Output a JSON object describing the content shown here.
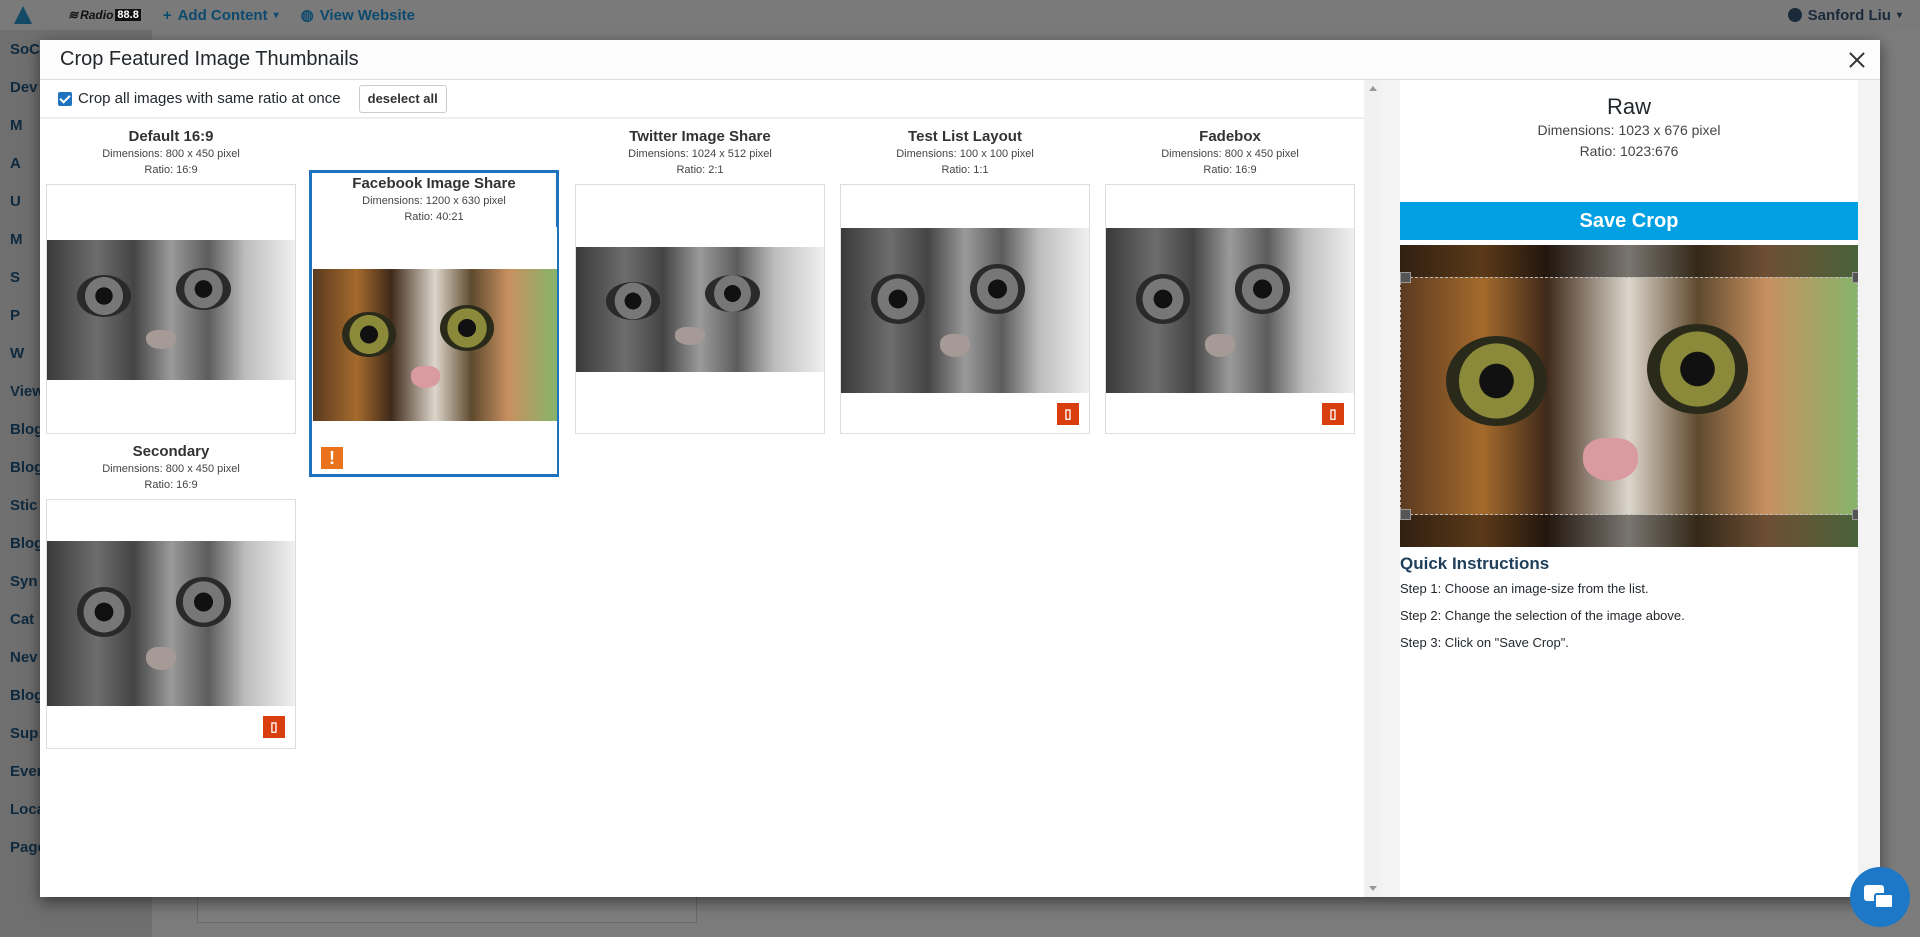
{
  "admin_bar": {
    "radio_logo_text": "Radio",
    "radio_logo_box": "88.8",
    "add_content": "Add Content",
    "view_website": "View Website",
    "user_name": "Sanford Liu"
  },
  "sidebar": {
    "items": [
      "SoCa",
      "Dev",
      "M",
      "A",
      "U",
      "M",
      "S",
      "P",
      "W",
      "View",
      "Blog",
      "Blog",
      "Stic",
      "Blog",
      "Syn",
      "Cat",
      "Nev",
      "Blog",
      "Sup",
      "Ever",
      "Loca",
      "Pages"
    ]
  },
  "modal": {
    "title": "Crop Featured Image Thumbnails",
    "crop_all_label": "Crop all images with same ratio at once",
    "deselect_all_label": "deselect all",
    "thumbnails": [
      {
        "title": "Default 16:9",
        "dimensions": "Dimensions: 800 x 450 pixel",
        "ratio": "Ratio: 16:9"
      },
      {
        "title": "Facebook Image Share",
        "dimensions": "Dimensions: 1200 x 630 pixel",
        "ratio": "Ratio: 40:21",
        "warning": "!"
      },
      {
        "title": "Twitter Image Share",
        "dimensions": "Dimensions: 1024 x 512 pixel",
        "ratio": "Ratio: 2:1"
      },
      {
        "title": "Test List Layout",
        "dimensions": "Dimensions: 100 x 100 pixel",
        "ratio": "Ratio: 1:1",
        "warning": "▯"
      },
      {
        "title": "Fadebox",
        "dimensions": "Dimensions: 800 x 450 pixel",
        "ratio": "Ratio: 16:9",
        "warning": "▯"
      },
      {
        "title": "Secondary",
        "dimensions": "Dimensions: 800 x 450 pixel",
        "ratio": "Ratio: 16:9",
        "warning": "▯"
      }
    ],
    "right": {
      "title": "Raw",
      "dimensions": "Dimensions: 1023 x 676 pixel",
      "ratio": "Ratio: 1023:676",
      "save_label": "Save Crop",
      "qi_title": "Quick Instructions",
      "steps": [
        "Step 1: Choose an image-size from the list.",
        "Step 2: Change the selection of the image above.",
        "Step 3: Click on \"Save Crop\"."
      ]
    }
  },
  "colors": {
    "accent": "#1e73be",
    "save_button": "#00a0e3",
    "warning_orange": "#e8731a",
    "warning_red": "#d93f0e"
  }
}
